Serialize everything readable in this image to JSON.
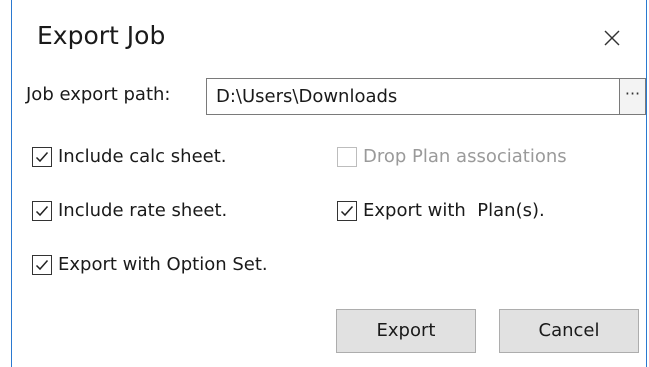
{
  "window": {
    "title": "Export Job"
  },
  "path": {
    "label": "Job export path:",
    "value": "D:\\Users\\Downloads",
    "browse_label": "···"
  },
  "options": [
    {
      "id": "include-calc-sheet",
      "label": "Include calc sheet.",
      "checked": true,
      "disabled": false
    },
    {
      "id": "drop-plan-associations",
      "label": "Drop Plan associations",
      "checked": false,
      "disabled": true
    },
    {
      "id": "include-rate-sheet",
      "label": "Include rate sheet.",
      "checked": true,
      "disabled": false
    },
    {
      "id": "export-with-plans",
      "label": "Export with  Plan(s).",
      "checked": true,
      "disabled": false
    },
    {
      "id": "export-with-option-set",
      "label": "Export with Option Set.",
      "checked": true,
      "disabled": false
    }
  ],
  "buttons": {
    "export": "Export",
    "cancel": "Cancel"
  },
  "colors": {
    "window_border": "#2b79d0",
    "button_face": "#e1e1e1",
    "disabled_text": "#9a9a9a"
  }
}
